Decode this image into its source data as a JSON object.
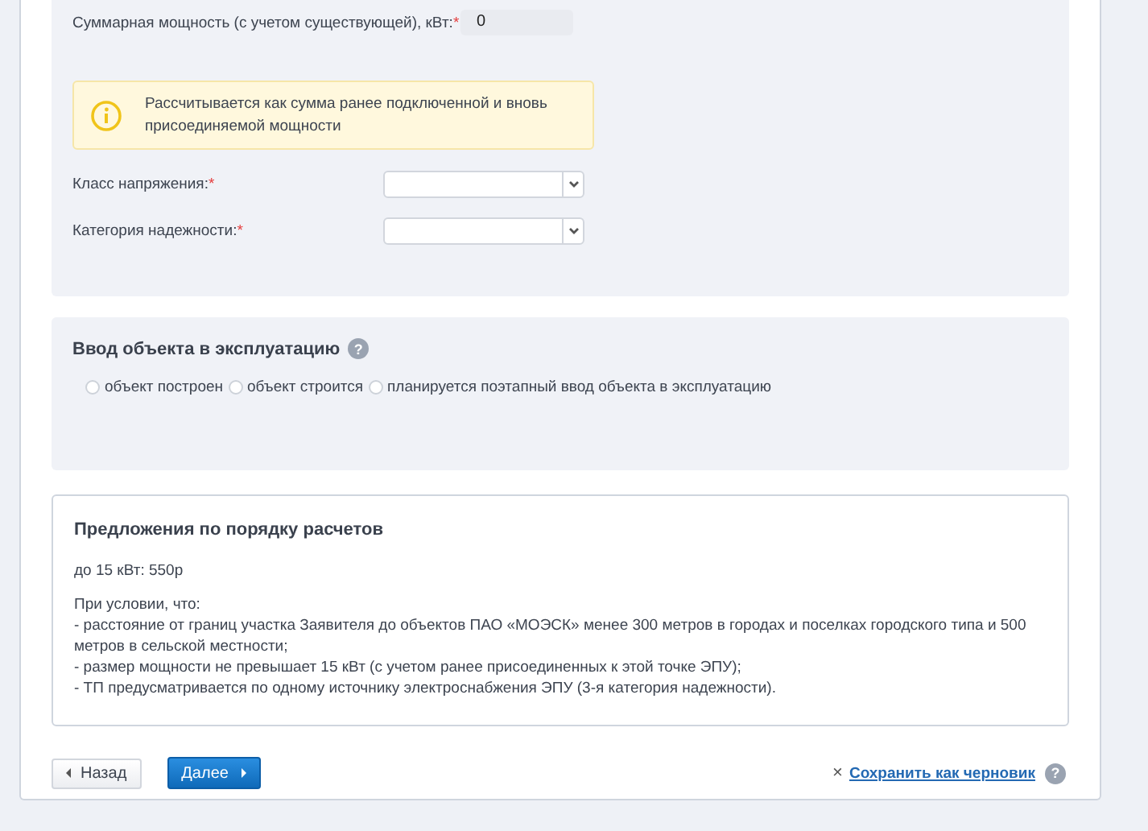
{
  "power": {
    "label": "Суммарная мощность (с учетом существующей), кВт:",
    "required_mark": "*",
    "value": "0"
  },
  "notice": {
    "text": "Рассчитывается как сумма ранее подключенной и вновь присоединяемой мощности"
  },
  "selects": [
    {
      "label": "Класс напряжения:",
      "required_mark": "*"
    },
    {
      "label": "Категория надежности:",
      "required_mark": "*"
    }
  ],
  "commissioning": {
    "title": "Ввод объекта в эксплуатацию",
    "help": "?",
    "options": [
      {
        "label": "объект построен",
        "selected": false
      },
      {
        "label": "объект строится",
        "selected": false
      },
      {
        "label": "планируется поэтапный ввод объекта в эксплуатацию",
        "selected": false
      }
    ]
  },
  "offer": {
    "title": "Предложения по порядку расчетов",
    "price": "до 15 кВт: 550р",
    "lines": [
      "При условии, что:",
      "- расстояние от границ участка Заявителя до объектов ПАО «МОЭСК» менее 300 метров в городах и поселках городского типа и 500 метров в сельской местности;",
      "- размер мощности не превышает 15 кВт (с учетом ранее присоединенных к этой точке ЭПУ);",
      "- ТП предусматривается по одному источнику электроснабжения ЭПУ (3-я категория надежности)."
    ]
  },
  "footer": {
    "back": "Назад",
    "next": "Далее",
    "close": "×",
    "save": "Сохранить как черновик",
    "help": "?"
  }
}
